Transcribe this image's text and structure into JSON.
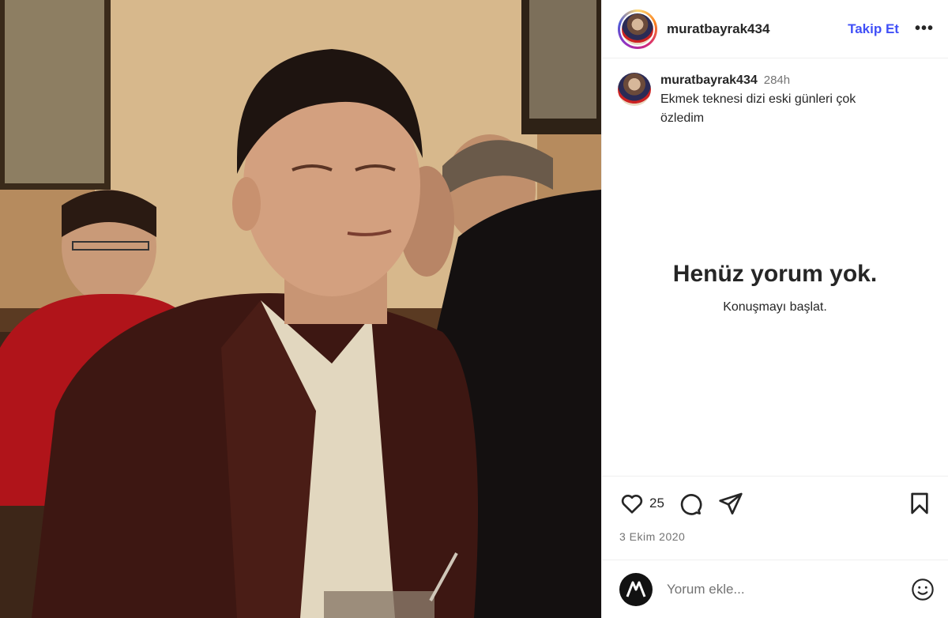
{
  "post": {
    "photo_icon": "post-photo",
    "header": {
      "username": "muratbayrak434",
      "follow_label": "Takip Et",
      "more_label": "•••"
    },
    "caption": {
      "username": "muratbayrak434",
      "time": "284h",
      "text": "Ekmek teknesi dizi eski günleri çok özledim"
    },
    "empty_state": {
      "title": "Henüz yorum yok.",
      "subtitle": "Konuşmayı başlat."
    },
    "actions": {
      "like_icon": "heart-icon",
      "likes_count": "25",
      "comment_icon": "comment-icon",
      "share_icon": "send-icon",
      "save_icon": "bookmark-icon"
    },
    "date": "3 Ekim 2020",
    "comment": {
      "placeholder": "Yorum ekle...",
      "emoji_icon": "emoji-icon"
    },
    "colors": {
      "accent": "#4150f7",
      "muted": "#737373",
      "border": "#efefef"
    }
  }
}
